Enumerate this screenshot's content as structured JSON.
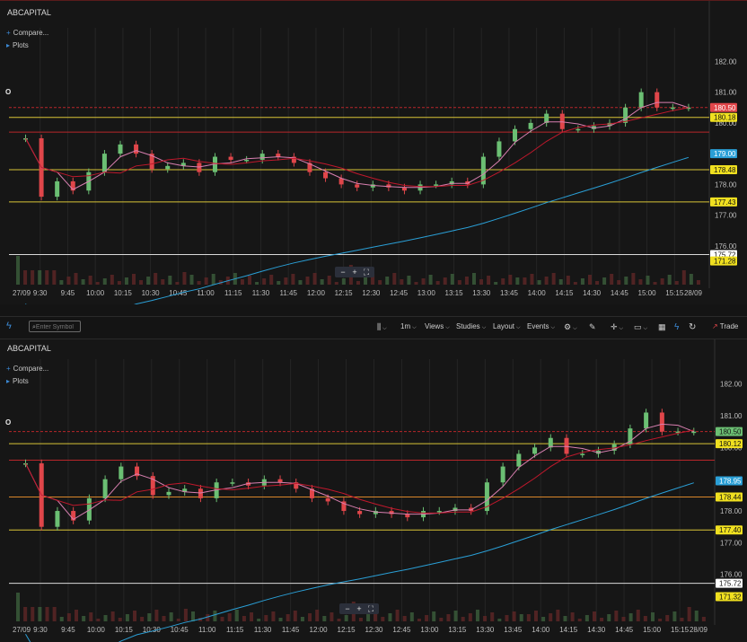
{
  "symbol": "ABCAPITAL",
  "compare_label": "Compare...",
  "plots_label": "Plots",
  "o_marker": "O",
  "toolbar": {
    "search_placeholder": "Enter Symbol",
    "interval": "1m",
    "views": "Views",
    "studies": "Studies",
    "layout": "Layout",
    "events": "Events",
    "trade": "Trade"
  },
  "zoom": {
    "minus": "−",
    "plus": "+",
    "fit": "⛶"
  },
  "colors": {
    "up": "#6bbf73",
    "down": "#e0464a",
    "vwap": "#2a9fd6",
    "ma_fast": "#d87fb0",
    "ma_slow": "#c0182c",
    "level_yellow": "#d8c437",
    "level_red": "#b8262a"
  },
  "chart_data": [
    {
      "type": "candlestick",
      "ylim": [
        175.5,
        182.8
      ],
      "y_ticks": [
        "182.00",
        "181.00",
        "180.00",
        "179.00",
        "178.00",
        "177.00",
        "176.00"
      ],
      "x_ticks": [
        "27/09",
        "9:30",
        "9:45",
        "10:00",
        "10:15",
        "10:30",
        "10:45",
        "11:00",
        "11:15",
        "11:30",
        "11:45",
        "12:00",
        "12:15",
        "12:30",
        "12:45",
        "13:00",
        "13:15",
        "13:30",
        "13:45",
        "14:00",
        "14:15",
        "14:30",
        "14:45",
        "15:00",
        "15:15",
        "28/09"
      ],
      "price_labels": [
        {
          "text": "180.50",
          "value": 180.5,
          "bg": "#e0464a",
          "fg": "#ffffff"
        },
        {
          "text": "180.18",
          "value": 180.18,
          "bg": "#f0e020",
          "fg": "#111111"
        },
        {
          "text": "179.00",
          "value": 179.0,
          "bg": "#2a9fd6",
          "fg": "#ffffff"
        },
        {
          "text": "178.48",
          "value": 178.48,
          "bg": "#f0e020",
          "fg": "#111111"
        },
        {
          "text": "177.43",
          "value": 177.43,
          "bg": "#f0e020",
          "fg": "#111111"
        },
        {
          "text": "175.72",
          "value": 175.72,
          "bg": "#ffffff",
          "fg": "#111111"
        },
        {
          "text": "171.28",
          "value": 175.51,
          "bg": "#f0e020",
          "fg": "#111111"
        }
      ],
      "levels": [
        {
          "value": 180.5,
          "color": "red",
          "dash": true
        },
        {
          "value": 180.18,
          "color": "yellow"
        },
        {
          "value": 179.7,
          "color": "red"
        },
        {
          "value": 178.48,
          "color": "yellow"
        },
        {
          "value": 177.43,
          "color": "yellow"
        },
        {
          "value": 175.72,
          "color": "white"
        }
      ],
      "close": [
        179.5,
        177.6,
        178.1,
        177.8,
        178.4,
        179.0,
        179.3,
        179.0,
        178.5,
        178.6,
        178.7,
        178.4,
        178.9,
        178.8,
        178.8,
        179.0,
        178.9,
        178.7,
        178.4,
        178.2,
        178.0,
        177.9,
        178.0,
        177.9,
        177.8,
        178.0,
        178.0,
        178.1,
        178.0,
        178.9,
        179.4,
        179.8,
        180.0,
        180.3,
        179.8,
        179.8,
        179.9,
        180.0,
        180.5,
        181.0,
        180.5,
        180.5,
        180.5
      ]
    },
    {
      "type": "candlestick",
      "ylim": [
        175.2,
        182.5
      ],
      "y_ticks": [
        "182.00",
        "181.00",
        "180.00",
        "179.00",
        "178.00",
        "177.00",
        "176.00"
      ],
      "x_ticks": [
        "27/09",
        "9:30",
        "9:45",
        "10:00",
        "10:15",
        "10:30",
        "10:45",
        "11:00",
        "11:15",
        "11:30",
        "11:45",
        "12:00",
        "12:15",
        "12:30",
        "12:45",
        "13:00",
        "13:15",
        "13:30",
        "13:45",
        "14:00",
        "14:15",
        "14:30",
        "14:45",
        "15:00",
        "15:15",
        "28/09"
      ],
      "price_labels": [
        {
          "text": "180.50",
          "value": 180.5,
          "bg": "#6bbf73",
          "fg": "#111111"
        },
        {
          "text": "180.12",
          "value": 180.12,
          "bg": "#f0e020",
          "fg": "#111111"
        },
        {
          "text": "178.95",
          "value": 178.95,
          "bg": "#2a9fd6",
          "fg": "#ffffff"
        },
        {
          "text": "178.44",
          "value": 178.44,
          "bg": "#f0e020",
          "fg": "#111111"
        },
        {
          "text": "177.40",
          "value": 177.4,
          "bg": "#f0e020",
          "fg": "#111111"
        },
        {
          "text": "175.72",
          "value": 175.72,
          "bg": "#ffffff",
          "fg": "#111111"
        },
        {
          "text": "171.32",
          "value": 175.3,
          "bg": "#f0e020",
          "fg": "#111111"
        }
      ],
      "levels": [
        {
          "value": 180.5,
          "color": "red",
          "dash": true
        },
        {
          "value": 180.12,
          "color": "yellow"
        },
        {
          "value": 179.6,
          "color": "red"
        },
        {
          "value": 178.44,
          "color": "orange"
        },
        {
          "value": 177.4,
          "color": "yellow"
        },
        {
          "value": 175.72,
          "color": "white"
        }
      ],
      "close": [
        179.5,
        177.5,
        178.0,
        177.7,
        178.4,
        179.0,
        179.4,
        179.1,
        178.5,
        178.6,
        178.7,
        178.4,
        178.9,
        178.9,
        178.8,
        179.0,
        178.9,
        178.7,
        178.4,
        178.3,
        178.0,
        177.9,
        178.0,
        177.9,
        177.8,
        178.0,
        178.0,
        178.1,
        178.0,
        178.9,
        179.4,
        179.8,
        180.0,
        180.3,
        179.8,
        179.8,
        179.9,
        180.1,
        180.6,
        181.1,
        180.5,
        180.5,
        180.5
      ]
    }
  ]
}
